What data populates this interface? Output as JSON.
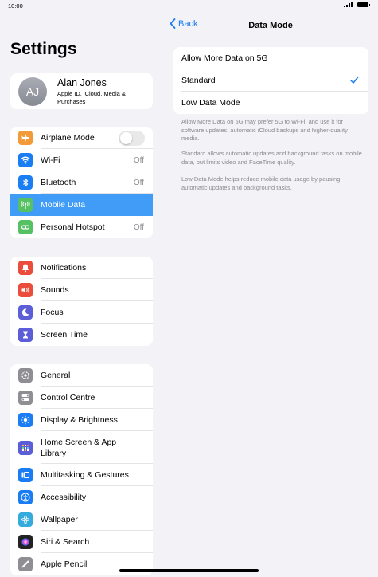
{
  "status": {
    "time": "10:00"
  },
  "sidebar": {
    "title": "Settings",
    "profile": {
      "initials": "AJ",
      "name": "Alan Jones",
      "subtitle": "Apple ID, iCloud, Media & Purchases"
    },
    "group1": [
      {
        "label": "Airplane Mode",
        "icon": "airplane-icon",
        "color": "#f19a37"
      },
      {
        "label": "Wi-Fi",
        "value": "Off",
        "icon": "wifi-icon",
        "color": "#1a7df4"
      },
      {
        "label": "Bluetooth",
        "value": "Off",
        "icon": "bluetooth-icon",
        "color": "#1a7df4"
      },
      {
        "label": "Mobile Data",
        "icon": "antenna-icon",
        "color": "#56c163",
        "selected": true
      },
      {
        "label": "Personal Hotspot",
        "value": "Off",
        "icon": "hotspot-icon",
        "color": "#56c163"
      }
    ],
    "group2": [
      {
        "label": "Notifications",
        "icon": "bell-icon",
        "color": "#eb4d3d"
      },
      {
        "label": "Sounds",
        "icon": "speaker-icon",
        "color": "#eb4d3d"
      },
      {
        "label": "Focus",
        "icon": "moon-icon",
        "color": "#5b5ed6"
      },
      {
        "label": "Screen Time",
        "icon": "hourglass-icon",
        "color": "#5b5ed6"
      }
    ],
    "group3": [
      {
        "label": "General",
        "icon": "gear-icon",
        "color": "#8e8e93"
      },
      {
        "label": "Control Centre",
        "icon": "switches-icon",
        "color": "#8e8e93"
      },
      {
        "label": "Display & Brightness",
        "icon": "sun-icon",
        "color": "#1a7df4"
      },
      {
        "label": "Home Screen & App Library",
        "icon": "grid-icon",
        "color": "#5b5ed6"
      },
      {
        "label": "Multitasking & Gestures",
        "icon": "multitask-icon",
        "color": "#1a7df4"
      },
      {
        "label": "Accessibility",
        "icon": "accessibility-icon",
        "color": "#1a7df4"
      },
      {
        "label": "Wallpaper",
        "icon": "flower-icon",
        "color": "#35aadc"
      },
      {
        "label": "Siri & Search",
        "icon": "siri-icon",
        "color": "#222222"
      },
      {
        "label": "Apple Pencil",
        "icon": "pencil-icon",
        "color": "#8e8e93"
      }
    ]
  },
  "detail": {
    "back_label": "Back",
    "title": "Data Mode",
    "options": [
      {
        "label": "Allow More Data on 5G",
        "checked": false
      },
      {
        "label": "Standard",
        "checked": true
      },
      {
        "label": "Low Data Mode",
        "checked": false
      }
    ],
    "footnotes": [
      "Allow More Data on 5G may prefer 5G to Wi-Fi, and use it for software updates, automatic iCloud backups and higher-quality media.",
      "Standard allows automatic updates and background tasks on mobile data, but limits video and FaceTime quality.",
      "Low Data Mode helps reduce mobile data usage by pausing automatic updates and background tasks."
    ]
  },
  "colors": {
    "accent": "#1a7df4",
    "selection": "#409cf7",
    "toggle_off": "#e9e9ea"
  }
}
